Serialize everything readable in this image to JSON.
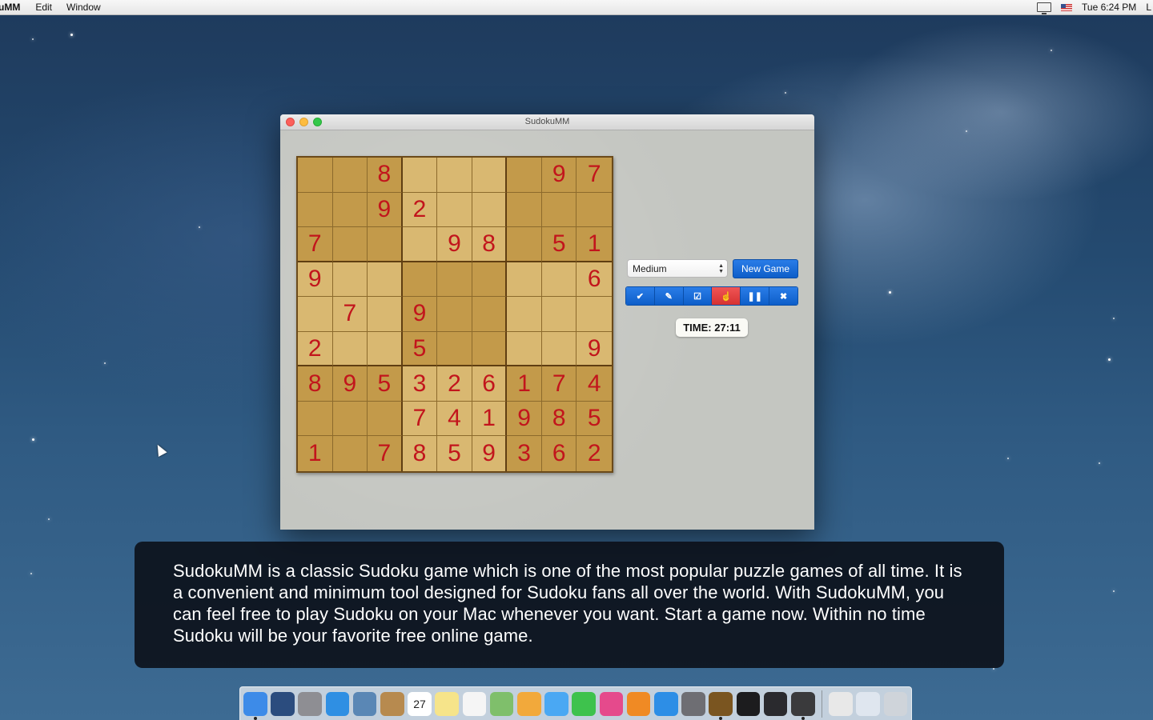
{
  "menubar": {
    "app_name": "uMM",
    "items": [
      "Edit",
      "Window"
    ],
    "clock": "Tue 6:24 PM",
    "trailing": "L"
  },
  "window": {
    "title": "SudokuMM"
  },
  "board": {
    "values": [
      [
        "",
        "",
        "8",
        "",
        "",
        "",
        "",
        "9",
        "7"
      ],
      [
        "",
        "",
        "9",
        "2",
        "",
        "",
        "",
        "",
        ""
      ],
      [
        "7",
        "",
        "",
        "",
        "9",
        "8",
        "",
        "5",
        "1"
      ],
      [
        "9",
        "",
        "",
        "",
        "",
        "",
        "",
        "",
        "6"
      ],
      [
        "",
        "7",
        "",
        "9",
        "",
        "",
        "",
        "",
        ""
      ],
      [
        "2",
        "",
        "",
        "5",
        "",
        "",
        "",
        "",
        "9"
      ],
      [
        "8",
        "9",
        "5",
        "3",
        "2",
        "6",
        "1",
        "7",
        "4"
      ],
      [
        "",
        "",
        "",
        "7",
        "4",
        "1",
        "9",
        "8",
        "5"
      ],
      [
        "1",
        "",
        "7",
        "8",
        "5",
        "9",
        "3",
        "6",
        "2"
      ]
    ],
    "digit_color": "#c2151c"
  },
  "controls": {
    "difficulty": "Medium",
    "new_game_label": "New Game",
    "timer": "TIME: 27:11",
    "toolbar": [
      {
        "name": "check-icon",
        "glyph": "✔"
      },
      {
        "name": "pencil-icon",
        "glyph": "✎"
      },
      {
        "name": "edit-note-icon",
        "glyph": "☑"
      },
      {
        "name": "hint-hand-icon",
        "glyph": "☝"
      },
      {
        "name": "pause-icon",
        "glyph": "❚❚"
      },
      {
        "name": "close-icon",
        "glyph": "✖"
      }
    ],
    "accent": "#1a6ad6",
    "active_tool_color": "#e04343"
  },
  "caption": {
    "text": "SudokuMM is a classic Sudoku game which is one of the most popular puzzle games of all time. It is a convenient and minimum tool designed for Sudoku fans all over the world. With SudokuMM, you can feel free to play Sudoku on your Mac whenever you want.  Start a game now. Within no time Sudoku will be your favorite free online game."
  },
  "dock": {
    "apps": [
      {
        "name": "finder-icon",
        "color": "#3d8be8"
      },
      {
        "name": "mission-control-icon",
        "color": "#2b4c7e"
      },
      {
        "name": "launchpad-icon",
        "color": "#8e8e93"
      },
      {
        "name": "safari-icon",
        "color": "#2f8fe3"
      },
      {
        "name": "mail-icon",
        "color": "#5a87b5"
      },
      {
        "name": "contacts-icon",
        "color": "#b78a4f"
      },
      {
        "name": "calendar-icon",
        "color": "#ffffff"
      },
      {
        "name": "notes-icon",
        "color": "#f6e48a"
      },
      {
        "name": "reminders-icon",
        "color": "#f5f5f5"
      },
      {
        "name": "maps-icon",
        "color": "#7fbf6b"
      },
      {
        "name": "photos-icon",
        "color": "#f2a93b"
      },
      {
        "name": "messages-icon",
        "color": "#4aa8f3"
      },
      {
        "name": "facetime-icon",
        "color": "#3ec24d"
      },
      {
        "name": "itunes-icon",
        "color": "#e54a8c"
      },
      {
        "name": "ibooks-icon",
        "color": "#f08a24"
      },
      {
        "name": "app-store-icon",
        "color": "#2d8ee6"
      },
      {
        "name": "system-preferences-icon",
        "color": "#6e6e73"
      },
      {
        "name": "sudokumm-icon",
        "color": "#7a5520"
      },
      {
        "name": "terminal-icon",
        "color": "#1c1c1e"
      },
      {
        "name": "activity-monitor-icon",
        "color": "#2a2a2e"
      },
      {
        "name": "x11-icon",
        "color": "#3a3a3c"
      }
    ],
    "stacks": [
      {
        "name": "documents-stack-icon",
        "color": "#e8e8e8"
      },
      {
        "name": "downloads-stack-icon",
        "color": "#dfe6ef"
      },
      {
        "name": "trash-icon",
        "color": "#cfd4da"
      }
    ],
    "calendar_day": "27"
  }
}
